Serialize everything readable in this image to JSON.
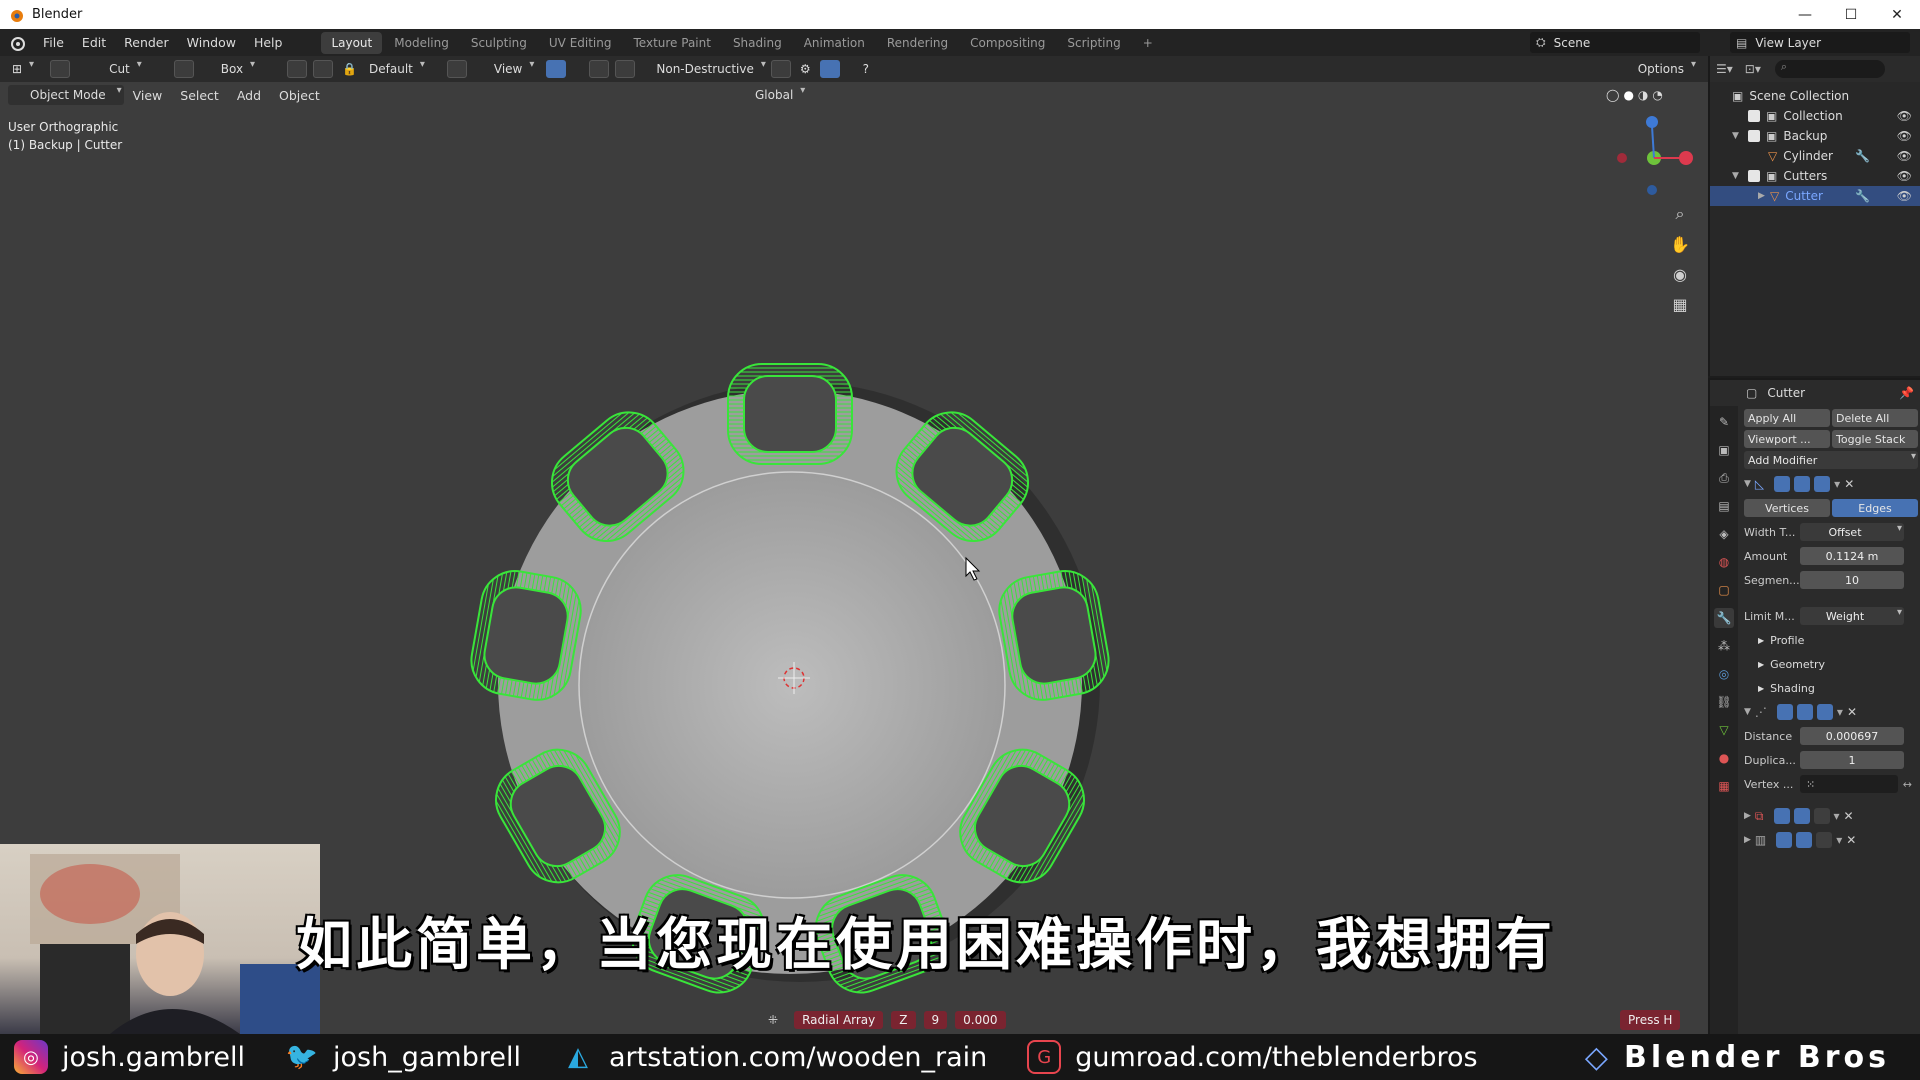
{
  "window": {
    "title": "Blender",
    "controls": [
      "—",
      "☐",
      "✕"
    ]
  },
  "menu": [
    "File",
    "Edit",
    "Render",
    "Window",
    "Help"
  ],
  "workspaces": [
    "Layout",
    "Modeling",
    "Sculpting",
    "UV Editing",
    "Texture Paint",
    "Shading",
    "Animation",
    "Rendering",
    "Compositing",
    "Scripting",
    "+"
  ],
  "active_workspace": "Layout",
  "scene": "Scene",
  "view_layer": "View Layer",
  "toolbar": {
    "cut": "Cut",
    "box": "Box",
    "default": "Default",
    "view": "View",
    "non_destructive": "Non-Destructive",
    "options": "Options"
  },
  "viewport_header": {
    "mode": "Object Mode",
    "view": "View",
    "select": "Select",
    "add": "Add",
    "object": "Object",
    "orientation": "Global"
  },
  "viewport_info": {
    "line1": "User Orthographic",
    "line2": "(1) Backup | Cutter"
  },
  "outliner": {
    "items": [
      {
        "label": "Scene Collection"
      },
      {
        "label": "Collection"
      },
      {
        "label": "Backup"
      },
      {
        "label": "Cylinder"
      },
      {
        "label": "Cutters"
      },
      {
        "label": "Cutter"
      }
    ]
  },
  "properties": {
    "object": "Cutter",
    "apply_all": "Apply All",
    "delete_all": "Delete All",
    "viewport": "Viewport ...",
    "toggle_stack": "Toggle Stack",
    "add_modifier": "Add Modifier",
    "vertices": "Vertices",
    "edges": "Edges",
    "width_label": "Width T...",
    "width_value": "Offset",
    "amount_label": "Amount",
    "amount_value": "0.1124 m",
    "segments_label": "Segmen...",
    "segments_value": "10",
    "limit_label": "Limit M...",
    "limit_value": "Weight",
    "profile": "Profile",
    "geometry": "Geometry",
    "shading": "Shading",
    "distance_label": "Distance",
    "distance_value": "0.000697",
    "duplica_label": "Duplica...",
    "duplica_value": "1",
    "vertex_label": "Vertex ..."
  },
  "operator": {
    "name": "Radial Array",
    "axis": "Z",
    "count": "9",
    "offset": "0.000"
  },
  "press_h": "Press H",
  "subtitle": "如此简单，当您现在使用困难操作时，我想拥有",
  "social": {
    "instagram": "josh.gambrell",
    "twitter": "josh_gambrell",
    "artstation": "artstation.com/wooden_rain",
    "gumroad": "gumroad.com/theblenderbros",
    "brand": "Blender Bros"
  },
  "colors": {
    "accent": "#4772b3",
    "cutter_green": "#39e53a",
    "viewport_bg": "#3d3d3d",
    "operator_red": "#7a2430"
  }
}
